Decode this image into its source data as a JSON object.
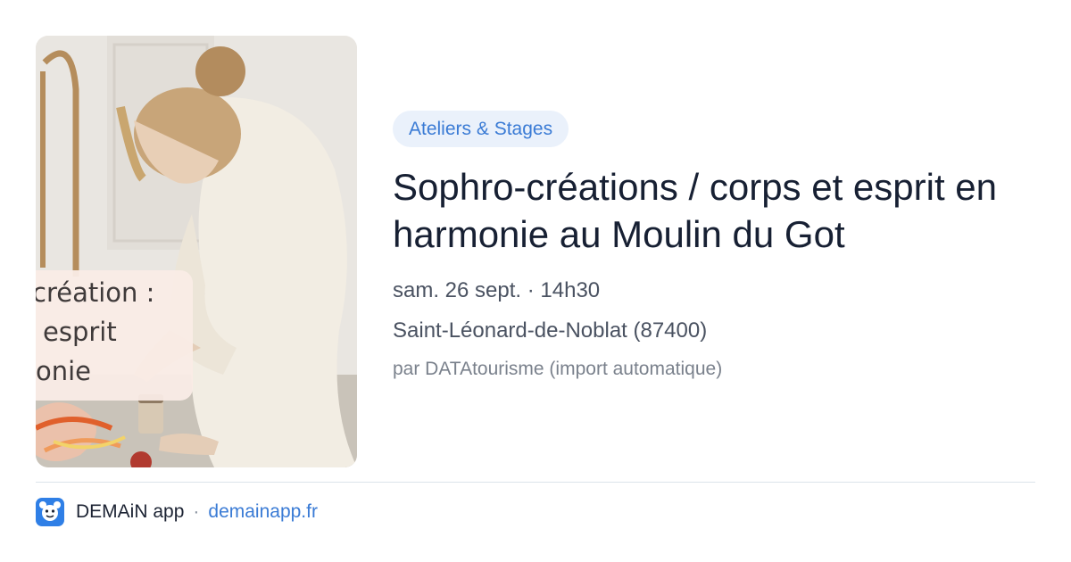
{
  "event": {
    "category_tag": "Ateliers & Stages",
    "title": "Sophro-créations / corps et esprit en harmonie au Moulin du Got",
    "date_time": "sam. 26 sept. · 14h30",
    "location": "Saint-Léonard-de-Noblat (87400)",
    "source": "par DATAtourisme (import automatique)",
    "image": {
      "overlay_lines": [
        "création :",
        "esprit",
        "onie"
      ]
    }
  },
  "footer": {
    "app_name": "DEMAiN app",
    "separator": "·",
    "url": "demainapp.fr",
    "icon": "demain-app-logo-icon"
  },
  "colors": {
    "tag_background": "#eaf1fb",
    "accent": "#3a7bd5",
    "title": "#172033",
    "app_icon": "#2f7fe6"
  }
}
